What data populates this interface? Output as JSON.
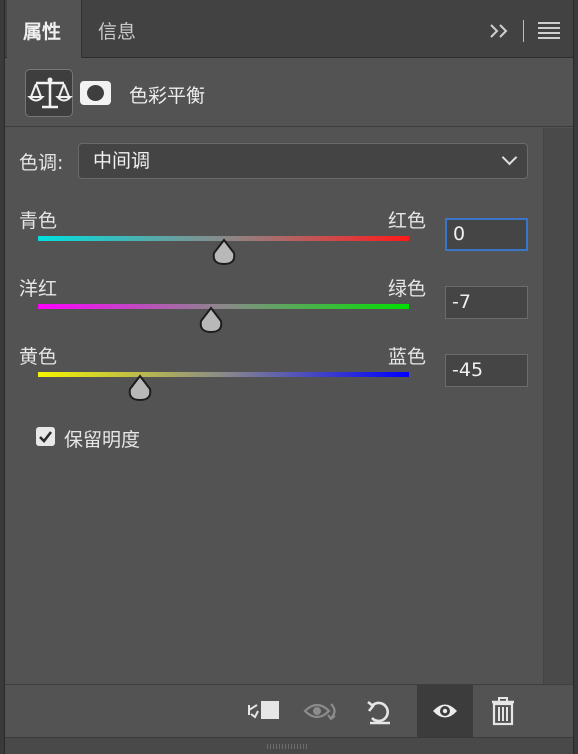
{
  "tabs": [
    {
      "label": "属性",
      "active": true
    },
    {
      "label": "信息",
      "active": false
    }
  ],
  "header": {
    "adjustment_title": "色彩平衡",
    "balance_icon": "balance-scale-icon",
    "mask_icon": "layer-mask-icon"
  },
  "tone": {
    "label": "色调:",
    "selected": "中间调"
  },
  "sliders": [
    {
      "left_label": "青色",
      "right_label": "红色",
      "value": "0",
      "level": 0,
      "gradient": [
        "#00e0e0",
        "#ff1a1a"
      ],
      "focused": true
    },
    {
      "left_label": "洋红",
      "right_label": "绿色",
      "value": "-7",
      "level": -7,
      "gradient": [
        "#ff00ff",
        "#00e000"
      ],
      "focused": false
    },
    {
      "left_label": "黄色",
      "right_label": "蓝色",
      "value": "-45",
      "level": -45,
      "gradient": [
        "#f5f500",
        "#0000ff"
      ],
      "focused": false
    }
  ],
  "slider_range": [
    -100,
    100
  ],
  "preserve_luminosity": {
    "label": "保留明度",
    "checked": true
  },
  "toolbar": {
    "icons": [
      "clip-to-layer-icon",
      "view-previous-state-icon",
      "reset-icon",
      "visibility-eye-icon",
      "trash-icon"
    ]
  },
  "colors": {
    "panel_bg": "#535353",
    "focus_border": "#3b75c9"
  }
}
